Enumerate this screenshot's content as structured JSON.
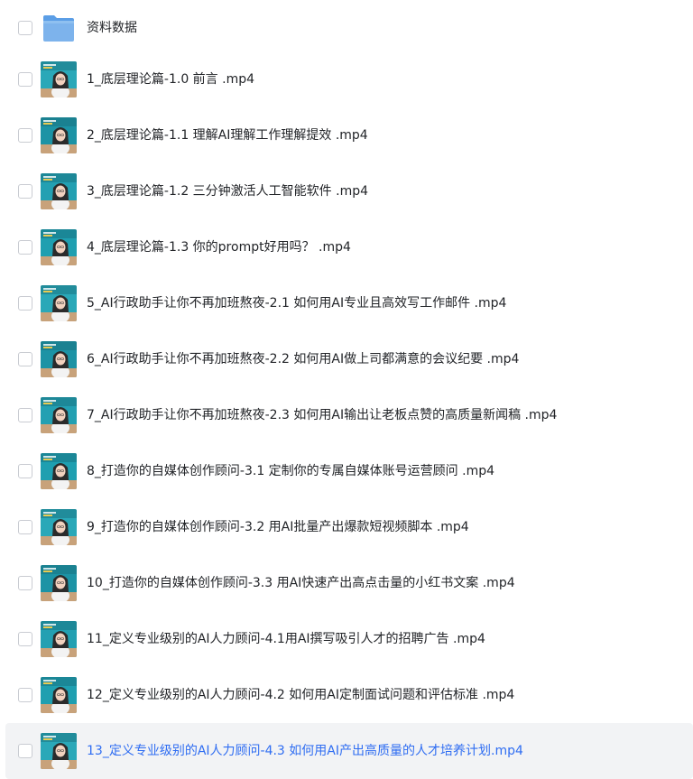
{
  "files": [
    {
      "name": "资料数据",
      "type": "folder",
      "icon": "folder-icon",
      "selected": false
    },
    {
      "name": "1_底层理论篇-1.0 前言 .mp4",
      "type": "video",
      "icon": "video-thumbnail",
      "selected": false
    },
    {
      "name": "2_底层理论篇-1.1 理解AI理解工作理解提效 .mp4",
      "type": "video",
      "icon": "video-thumbnail",
      "selected": false
    },
    {
      "name": "3_底层理论篇-1.2 三分钟激活人工智能软件 .mp4",
      "type": "video",
      "icon": "video-thumbnail",
      "selected": false
    },
    {
      "name": "4_底层理论篇-1.3 你的prompt好用吗？ .mp4",
      "type": "video",
      "icon": "video-thumbnail",
      "selected": false
    },
    {
      "name": "5_AI行政助手让你不再加班熬夜-2.1 如何用AI专业且高效写工作邮件 .mp4",
      "type": "video",
      "icon": "video-thumbnail",
      "selected": false
    },
    {
      "name": "6_AI行政助手让你不再加班熬夜-2.2 如何用AI做上司都满意的会议纪要 .mp4",
      "type": "video",
      "icon": "video-thumbnail",
      "selected": false
    },
    {
      "name": "7_AI行政助手让你不再加班熬夜-2.3 如何用AI输出让老板点赞的高质量新闻稿 .mp4",
      "type": "video",
      "icon": "video-thumbnail",
      "selected": false
    },
    {
      "name": "8_打造你的自媒体创作顾问-3.1 定制你的专属自媒体账号运营顾问 .mp4",
      "type": "video",
      "icon": "video-thumbnail",
      "selected": false
    },
    {
      "name": "9_打造你的自媒体创作顾问-3.2 用AI批量产出爆款短视频脚本 .mp4",
      "type": "video",
      "icon": "video-thumbnail",
      "selected": false
    },
    {
      "name": "10_打造你的自媒体创作顾问-3.3 用AI快速产出高点击量的小红书文案 .mp4",
      "type": "video",
      "icon": "video-thumbnail",
      "selected": false
    },
    {
      "name": "11_定义专业级别的AI人力顾问-4.1用AI撰写吸引人才的招聘广告 .mp4",
      "type": "video",
      "icon": "video-thumbnail",
      "selected": false
    },
    {
      "name": "12_定义专业级别的AI人力顾问-4.2 如何用AI定制面试问题和评估标准 .mp4",
      "type": "video",
      "icon": "video-thumbnail",
      "selected": false
    },
    {
      "name": "13_定义专业级别的AI人力顾问-4.3 如何用AI产出高质量的人才培养计划.mp4",
      "type": "video",
      "icon": "video-thumbnail",
      "selected": false,
      "hovered": true
    }
  ],
  "colors": {
    "hover_bg": "#f2f3f5",
    "hover_text": "#2f6df2",
    "text": "#222428",
    "folder": "#7db3ec",
    "thumb_bg": "#1f9fb0"
  }
}
